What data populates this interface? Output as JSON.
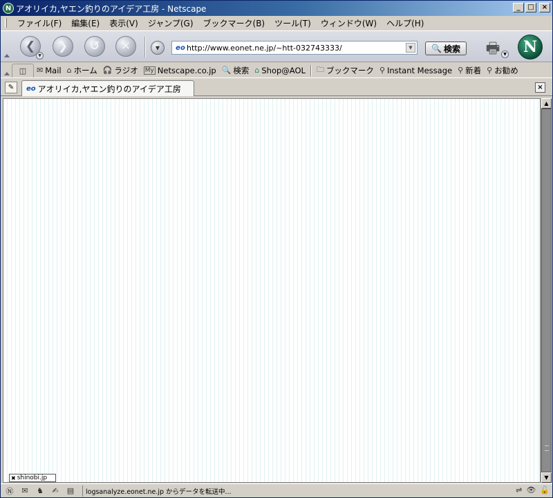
{
  "window": {
    "title": "アオリイカ,ヤエン釣りのアイデア工房 - Netscape",
    "app_icon": "N",
    "buttons": {
      "minimize": "_",
      "maximize": "□",
      "close": "×"
    }
  },
  "menu": {
    "items": [
      {
        "id": "file",
        "label": "ファイル(F)"
      },
      {
        "id": "edit",
        "label": "編集(E)"
      },
      {
        "id": "view",
        "label": "表示(V)"
      },
      {
        "id": "go",
        "label": "ジャンプ(G)"
      },
      {
        "id": "bookmarks",
        "label": "ブックマーク(B)"
      },
      {
        "id": "tools",
        "label": "ツール(T)"
      },
      {
        "id": "window",
        "label": "ウィンドウ(W)"
      },
      {
        "id": "help",
        "label": "ヘルプ(H)"
      }
    ]
  },
  "nav": {
    "back_glyph": "❮",
    "forward_glyph": "❯",
    "reload_glyph": "↺",
    "stop_glyph": "✕",
    "url": "http://www.eonet.ne.jp/~htt-032743333/",
    "url_icon": "eo",
    "search_label": "検索",
    "search_icon": "magnifier-icon",
    "logo_letter": "N"
  },
  "personal_toolbar": {
    "items": [
      {
        "id": "mail",
        "icon": "✉",
        "label": "Mail"
      },
      {
        "id": "home",
        "icon": "⌂",
        "label": "ホーム"
      },
      {
        "id": "radio",
        "icon": "🎧",
        "label": "ラジオ"
      },
      {
        "id": "netscape",
        "icon": "My",
        "label": "Netscape.co.jp"
      },
      {
        "id": "search",
        "icon": "🔍",
        "label": "検索"
      },
      {
        "id": "shop",
        "icon": "⌂",
        "label": "Shop@AOL"
      }
    ],
    "bookmark_items": [
      {
        "id": "bookmarks",
        "icon": "🗀",
        "label": "ブックマーク"
      },
      {
        "id": "instant",
        "icon": "⚲",
        "label": "Instant Message"
      },
      {
        "id": "new",
        "icon": "⚲",
        "label": "新着"
      },
      {
        "id": "recommend",
        "icon": "⚲",
        "label": "お勧め"
      }
    ]
  },
  "tab": {
    "icon": "eo",
    "title": "アオリイカ,ヤエン釣りのアイデア工房",
    "close": "×"
  },
  "content": {
    "badge": "shinobi.jp"
  },
  "status": {
    "text": "logsanalyze.eonet.ne.jp からデータを転送中..."
  }
}
